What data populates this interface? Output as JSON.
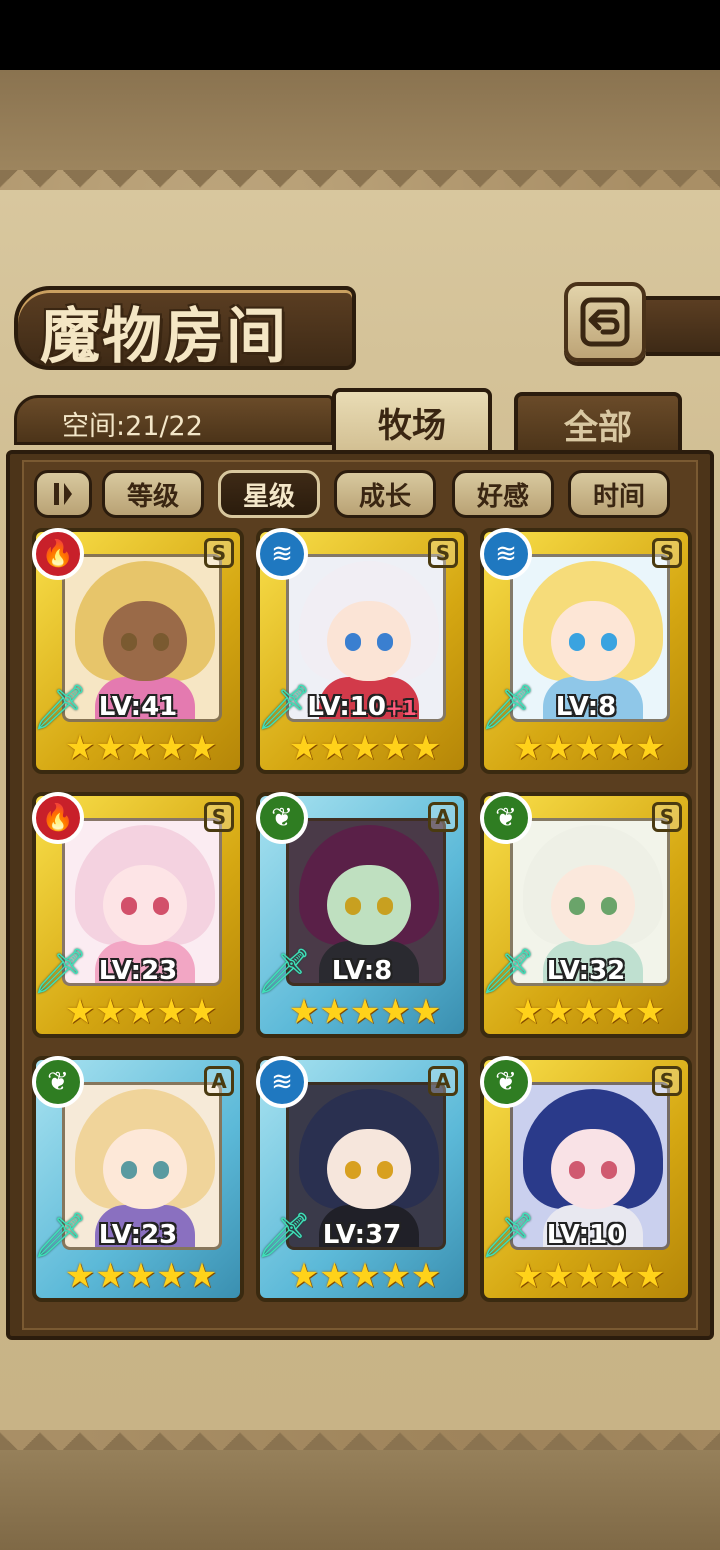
{
  "header": {
    "title": "魔物房间"
  },
  "capacity": {
    "label": "空间:21/22"
  },
  "tabs": [
    {
      "label": "牧场",
      "active": true
    },
    {
      "label": "全部",
      "active": false
    }
  ],
  "filters": {
    "toggle_icon": "sort-toggle-icon",
    "items": [
      {
        "label": "等级",
        "selected": false
      },
      {
        "label": "星级",
        "selected": true
      },
      {
        "label": "成长",
        "selected": false
      },
      {
        "label": "好感",
        "selected": false
      },
      {
        "label": "时间",
        "selected": false
      }
    ]
  },
  "colors": {
    "fire": "#c8202a",
    "water": "#1f78c0",
    "nature": "#2f7d22",
    "gold_frame": "#e8c22a",
    "blue_frame": "#6cc3df"
  },
  "monsters": [
    {
      "element": "fire",
      "rank": "S",
      "level": "LV:41",
      "plus": "",
      "stars": 5,
      "hair": "#e7c56a",
      "skin": "#9a6a48",
      "eye": "#7a5a30",
      "outfit": "#e47ab0",
      "bg": "#f6e6c4"
    },
    {
      "element": "water",
      "rank": "S",
      "level": "LV:10",
      "plus": "+1",
      "stars": 5,
      "hair": "#f1eef4",
      "skin": "#fbe4d6",
      "eye": "#3a7fd0",
      "outfit": "#d23a4a",
      "bg": "#eef0f6"
    },
    {
      "element": "water",
      "rank": "S",
      "level": "LV:8",
      "plus": "",
      "stars": 5,
      "hair": "#f6dc7a",
      "skin": "#fde6d6",
      "eye": "#3aa3e0",
      "outfit": "#8fc7e8",
      "bg": "#eaf6fb"
    },
    {
      "element": "fire",
      "rank": "S",
      "level": "LV:23",
      "plus": "",
      "stars": 5,
      "hair": "#f4d2e0",
      "skin": "#fde4e6",
      "eye": "#d2506a",
      "outfit": "#f2a6c4",
      "bg": "#fbecf2"
    },
    {
      "element": "nature",
      "rank": "A",
      "level": "LV:8",
      "plus": "",
      "stars": 5,
      "hair": "#5a2048",
      "skin": "#bfe0c0",
      "eye": "#c8a020",
      "outfit": "#2a2a30",
      "bg": "#4a3a48"
    },
    {
      "element": "nature",
      "rank": "S",
      "level": "LV:32",
      "plus": "",
      "stars": 5,
      "hair": "#eef0e6",
      "skin": "#fbe8dc",
      "eye": "#6aa46a",
      "outfit": "#bfe0d0",
      "bg": "#f2f4ea"
    },
    {
      "element": "nature",
      "rank": "A",
      "level": "LV:23",
      "plus": "",
      "stars": 5,
      "hair": "#f0d49a",
      "skin": "#fde8d8",
      "eye": "#5a9aa0",
      "outfit": "#8a70c0",
      "bg": "#f6ead8"
    },
    {
      "element": "water",
      "rank": "A",
      "level": "LV:37",
      "plus": "",
      "stars": 5,
      "hair": "#2a3050",
      "skin": "#f6e6dc",
      "eye": "#d8a020",
      "outfit": "#202028",
      "bg": "#3a3a4a"
    },
    {
      "element": "nature",
      "rank": "S",
      "level": "LV:10",
      "plus": "",
      "stars": 5,
      "hair": "#2a3a8a",
      "skin": "#f9e2e6",
      "eye": "#d05a70",
      "outfit": "#e8e8f0",
      "bg": "#cad0ee"
    }
  ]
}
